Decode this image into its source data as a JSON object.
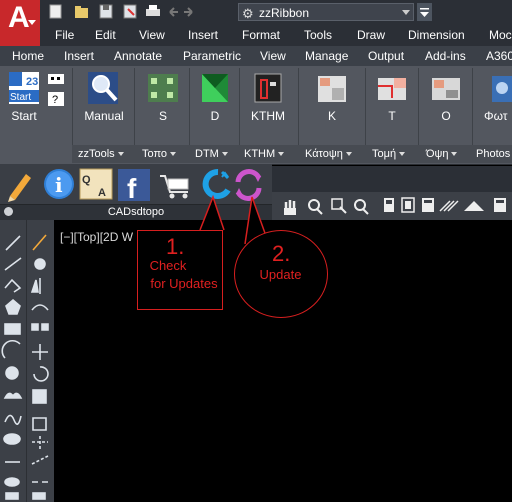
{
  "title_bar": {
    "workspace_name": "zzRibbon",
    "qat_icons": [
      "new-file-icon",
      "open-folder-icon",
      "save-icon",
      "save-as-icon",
      "print-icon",
      "undo-icon",
      "redo-icon"
    ]
  },
  "menu": [
    "File",
    "Edit",
    "View",
    "Insert",
    "Format",
    "Tools",
    "Draw",
    "Dimension",
    "Moc"
  ],
  "ribbon_tabs": [
    "Home",
    "Insert",
    "Annotate",
    "Parametric",
    "View",
    "Manage",
    "Output",
    "Add-ins",
    "A360"
  ],
  "ribbon_buttons": [
    {
      "label": "Start",
      "icon": "start-icon"
    },
    {
      "label": "Manual",
      "icon": "manual-magnifier-icon"
    },
    {
      "label": "S",
      "icon": "survey-points-icon"
    },
    {
      "label": "D",
      "icon": "dtm-triangle-icon"
    },
    {
      "label": "KTHM",
      "icon": "property-icon"
    },
    {
      "label": "K",
      "icon": "plan-view-icon"
    },
    {
      "label": "T",
      "icon": "section-icon"
    },
    {
      "label": "O",
      "icon": "elevation-icon"
    },
    {
      "label": "Φωτ",
      "icon": "photos-icon"
    }
  ],
  "ribbon_groups": [
    "zzTools",
    "Τοπο",
    "DTM",
    "KTHM",
    "Κάτοψη",
    "Τομή",
    "Όψη",
    "Photos"
  ],
  "floating_toolbar": {
    "title": "CADsdtopo",
    "icons": [
      "pencil-icon",
      "info-icon",
      "qa-icon",
      "facebook-icon",
      "cart-icon",
      "check-updates-icon",
      "update-icon"
    ]
  },
  "viewport": {
    "label": "[−][Top][2D W"
  },
  "annotations": {
    "step1_number": "1.",
    "step1_text_line1": "Check",
    "step1_text_line2": "for Updates",
    "step2_number": "2.",
    "step2_text": "Update",
    "color": "#e02020"
  },
  "colors": {
    "app_red": "#c8282b",
    "ribbon_bg": "#53575f",
    "toolbar_bg": "#3c4047"
  }
}
